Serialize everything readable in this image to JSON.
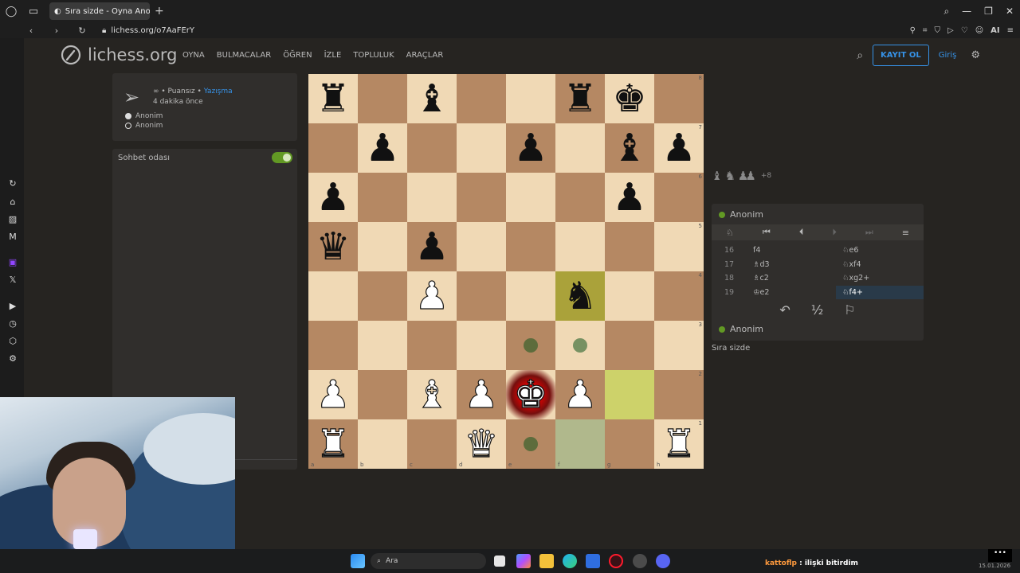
{
  "browser": {
    "tab_title": "Sıra sizde - Oyna Anon.",
    "url": "lichess.org/o7AaFErY",
    "ai_label": "AI"
  },
  "site": {
    "logo": "lichess.org",
    "menu": [
      "OYNA",
      "BULMACALAR",
      "ÖĞREN",
      "İZLE",
      "TOPLULUK",
      "ARAÇLAR"
    ],
    "signup": "KAYIT OL",
    "login": "Giriş"
  },
  "game_info": {
    "line1_prefix": "∞ • Puansız •",
    "line1_link": "Yazışma",
    "time_ago": "4 dakika önce",
    "white_player": "Anonim",
    "black_player": "Anonim"
  },
  "chat": {
    "label": "Sohbet odası",
    "enabled": true
  },
  "board": {
    "files": [
      "a",
      "b",
      "c",
      "d",
      "e",
      "f",
      "g",
      "h"
    ],
    "ranks": [
      "8",
      "7",
      "6",
      "5",
      "4",
      "3",
      "2",
      "1"
    ],
    "rows": [
      [
        "bR",
        "",
        "bB",
        "",
        "",
        "bR",
        "bK",
        ""
      ],
      [
        "",
        "bP",
        "",
        "",
        "bP",
        "",
        "bB",
        "bP"
      ],
      [
        "bP",
        "",
        "",
        "",
        "",
        "",
        "bP",
        ""
      ],
      [
        "bQ",
        "",
        "bP",
        "",
        "",
        "",
        "",
        ""
      ],
      [
        "",
        "",
        "wP",
        "",
        "",
        "bN",
        "",
        ""
      ],
      [
        "",
        "",
        "",
        "",
        "",
        "",
        "",
        ""
      ],
      [
        "wP",
        "",
        "wB",
        "wP",
        "wK",
        "wP",
        "",
        ""
      ],
      [
        "wR",
        "",
        "",
        "wQ",
        "",
        "",
        "",
        "wR"
      ]
    ],
    "last_move": [
      "g2",
      "f4"
    ],
    "check_square": "e2",
    "hover_square": "f1",
    "move_dots": [
      "e3",
      "f3",
      "e1"
    ]
  },
  "captured": {
    "pieces": [
      "♝",
      "♞",
      "♟",
      "♟"
    ],
    "advantage": "+8"
  },
  "moves_panel": {
    "top_player": "Anonim",
    "bottom_player": "Anonim",
    "moves": [
      {
        "no": "16",
        "white": "f4",
        "black": "♘e6"
      },
      {
        "no": "17",
        "white": "♗d3",
        "black": "♘xf4"
      },
      {
        "no": "18",
        "white": "♗c2",
        "black": "♘xg2+"
      },
      {
        "no": "19",
        "white": "♔e2",
        "black": "♘f4+"
      }
    ],
    "status": "Sıra sizde",
    "draw_label": "½"
  },
  "taskbar": {
    "search_placeholder": "Ara",
    "chat_user": "kattoflp",
    "chat_message": ": ilişki bitirdim",
    "date": "15.01.2026"
  }
}
